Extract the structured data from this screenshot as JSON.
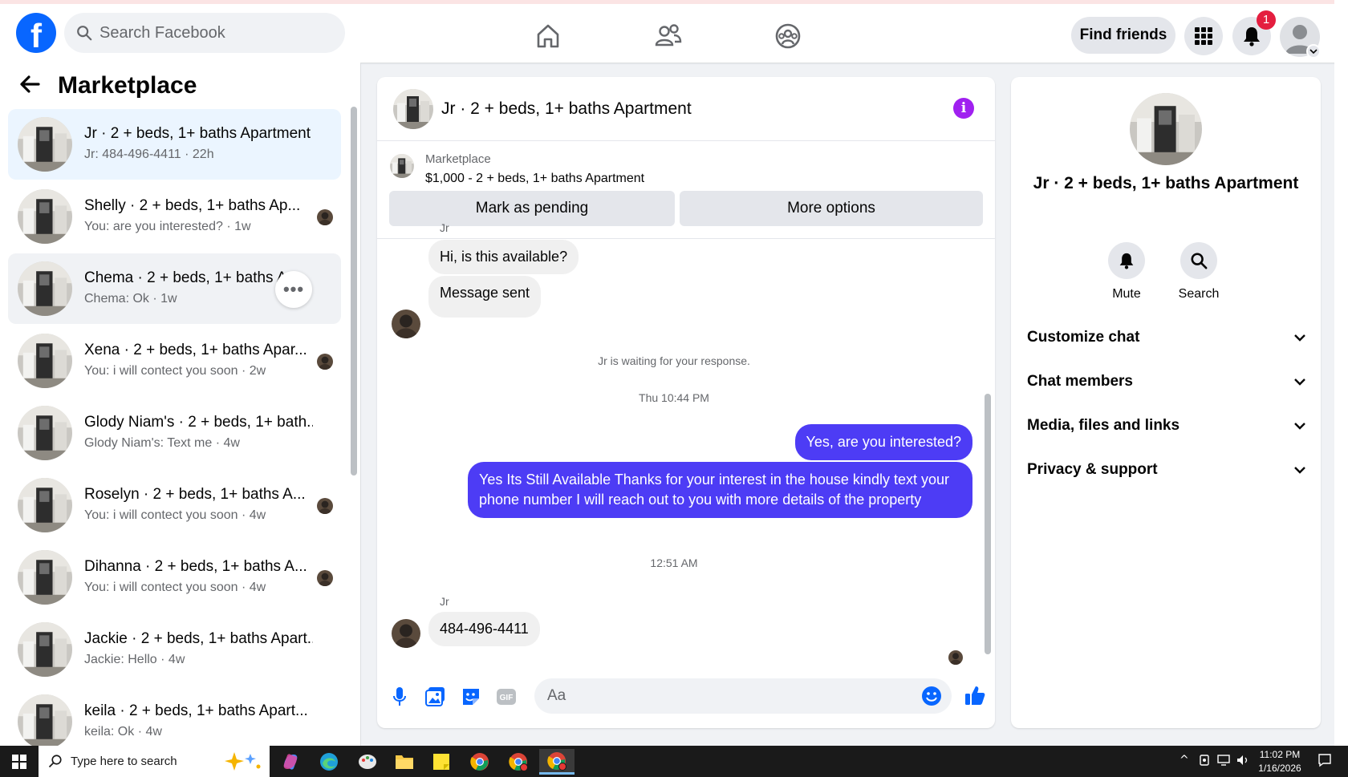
{
  "topbar": {
    "search_placeholder": "Search Facebook",
    "find_friends": "Find friends",
    "notification_count": "1"
  },
  "sidebar": {
    "title": "Marketplace",
    "conversations": [
      {
        "name": "Jr · 2 + beds, 1+ baths Apartment",
        "sub": "Jr: 484-496-4411 · 22h"
      },
      {
        "name": "Shelly · 2 + beds, 1+ baths Ap...",
        "sub": "You: are you interested? · 1w"
      },
      {
        "name": "Chema · 2 + beds, 1+ baths Apa...",
        "sub": "Chema: Ok · 1w"
      },
      {
        "name": "Xena · 2 + beds, 1+ baths Apar...",
        "sub": "You: i will contect you soon · 2w"
      },
      {
        "name": "Glody Niam's · 2 + beds, 1+ bath...",
        "sub": "Glody Niam's: Text me · 4w"
      },
      {
        "name": "Roselyn · 2 + beds, 1+ baths A...",
        "sub": "You: i will contect you soon · 4w"
      },
      {
        "name": "Dihanna · 2 + beds, 1+ baths A...",
        "sub": "You: i will contect you soon · 4w"
      },
      {
        "name": "Jackie · 2 + beds, 1+ baths Apart...",
        "sub": "Jackie: Hello · 4w"
      },
      {
        "name": "keila · 2 + beds, 1+ baths Apart...",
        "sub": "keila: Ok · 4w"
      }
    ]
  },
  "chat": {
    "title": "Jr · 2 + beds, 1+ baths Apartment",
    "marketplace_label": "Marketplace",
    "listing": "$1,000 - 2 + beds, 1+ baths Apartment",
    "mark_pending": "Mark as pending",
    "more_options": "More options",
    "author_1": "Jr",
    "msg_1": "Hi, is this available?",
    "msg_2": "Message sent",
    "waiting_note": "Jr is waiting for your response.",
    "time_1": "Thu 10:44 PM",
    "out_1": "Yes, are you interested?",
    "out_2": "Yes Its Still Available Thanks for your interest in the house kindly text your phone number I will reach out to you with more details of the property",
    "time_2": "12:51 AM",
    "author_2": "Jr",
    "msg_3": "484-496-4411",
    "composer_placeholder": "Aa"
  },
  "right_panel": {
    "title": "Jr · 2 + beds, 1+ baths Apartment",
    "mute": "Mute",
    "search": "Search",
    "rows": [
      "Customize chat",
      "Chat members",
      "Media, files and links",
      "Privacy & support"
    ]
  },
  "taskbar": {
    "search_text": "Type here to search",
    "time": "11:02 PM",
    "date": "1/16/2026"
  },
  "colors": {
    "brand": "#0866ff",
    "outgoing_bubble": "#4d3cf5",
    "active_conv": "#ebf5ff",
    "info_icon": "#a020f0"
  }
}
